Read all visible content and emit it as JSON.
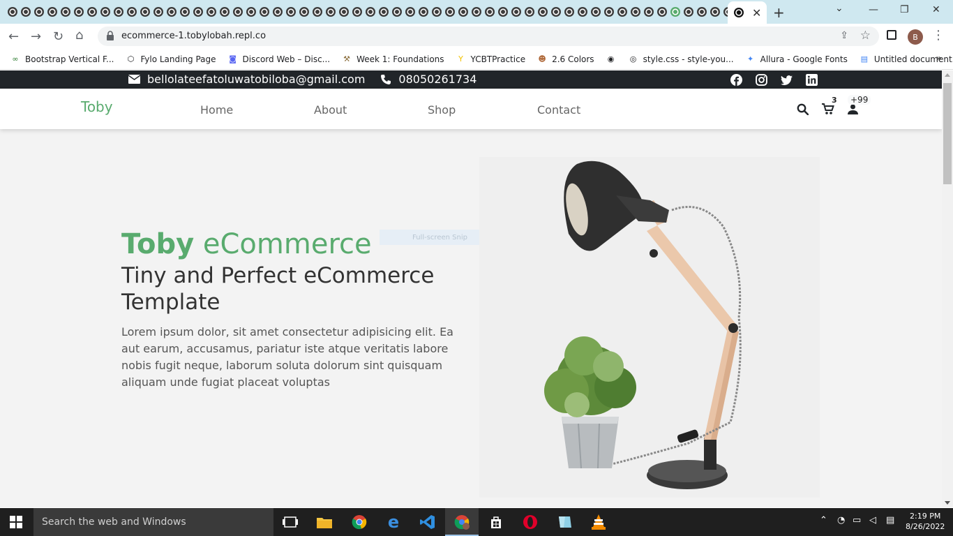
{
  "browser": {
    "tab_close": "✕",
    "new_tab": "+",
    "url": "ecommerce-1.tobylobah.repl.co",
    "profile_initial": "B",
    "bookmarks": [
      {
        "label": "Bootstrap Vertical F..."
      },
      {
        "label": "Fylo Landing Page"
      },
      {
        "label": "Discord Web – Disc..."
      },
      {
        "label": "Week 1: Foundations"
      },
      {
        "label": "YCBTPractice"
      },
      {
        "label": "2.6 Colors"
      },
      {
        "label": ""
      },
      {
        "label": "style.css - style-you..."
      },
      {
        "label": "Allura - Google Fonts"
      },
      {
        "label": "Untitled document..."
      }
    ]
  },
  "topbar": {
    "email": "bellolateefatoluwatobiloba@gmail.com",
    "phone": "08050261734"
  },
  "nav": {
    "brand": "Toby",
    "links": [
      "Home",
      "About",
      "Shop",
      "Contact"
    ],
    "cart_count": "3",
    "user_count": "+99"
  },
  "hero": {
    "title_bold": "Toby",
    "title_rest": " eCommerce",
    "subtitle": "Tiny and Perfect eCommerce Template",
    "body": "Lorem ipsum dolor, sit amet consectetur adipisicing elit. Ea aut earum, accusamus, pariatur iste atque veritatis labore nobis fugit neque, laborum soluta dolorum sint quisquam aliquam unde fugiat placeat voluptas"
  },
  "overlay": {
    "snip_label": "Full-screen Snip"
  },
  "taskbar": {
    "search_placeholder": "Search the web and Windows",
    "time": "2:19 PM",
    "date": "8/26/2022"
  },
  "colors": {
    "brand_green": "#59ab6e",
    "topbar_dark": "#212529",
    "tabstrip": "#cfe8f0"
  }
}
